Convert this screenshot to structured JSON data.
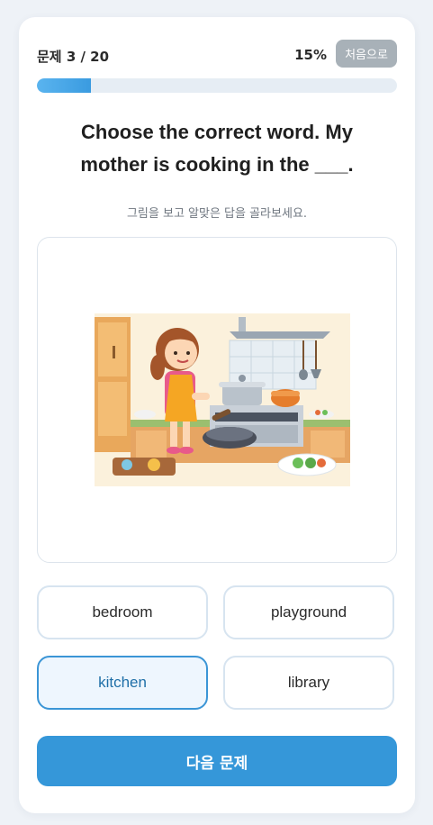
{
  "header": {
    "counter": "문제 3 / 20",
    "percent": "15%",
    "reset_label": "처음으로"
  },
  "progress": {
    "value": 0.15
  },
  "question": {
    "text": "Choose the correct word. My mother is cooking in the ___."
  },
  "instruction": "그림을 보고 알맞은 답을 골라보세요.",
  "illustration": {
    "icon": "girl-cooking-in-kitchen-image"
  },
  "options": [
    {
      "label": "bedroom",
      "selected": false
    },
    {
      "label": "playground",
      "selected": false
    },
    {
      "label": "kitchen",
      "selected": true
    },
    {
      "label": "library",
      "selected": false
    }
  ],
  "next_button": {
    "label": "다음 문제"
  },
  "colors": {
    "accent": "#3597d9",
    "selected_bg": "#eef6fe",
    "reset_bg": "#a8b1b8"
  }
}
